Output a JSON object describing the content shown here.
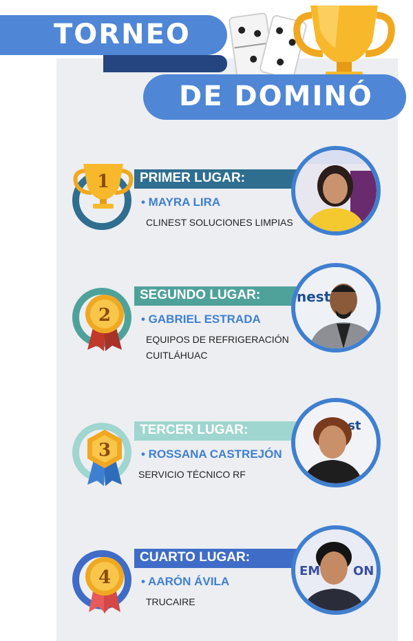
{
  "header": {
    "line1": "TORNEO",
    "line2": "DE DOMINÓ"
  },
  "colors": {
    "brand_blue": "#4f86d6",
    "dark_blue": "#24457f",
    "place1": "#2f6e8f",
    "place2": "#4fa29a",
    "place3": "#9fd6cf",
    "place4": "#3f6cc6",
    "name_blue": "#3f7fd0"
  },
  "entries": [
    {
      "place": "PRIMER LUGAR:",
      "number": "1",
      "name": "• MAYRA LIRA",
      "company": "CLINEST SOLUCIONES LIMPIAS",
      "icon": "trophy-icon"
    },
    {
      "place": "SEGUNDO LUGAR:",
      "number": "2",
      "name": "• GABRIEL ESTRADA",
      "company": "EQUIPOS DE REFRIGERACIÓN CUITLÁHUAC",
      "icon": "medal-icon"
    },
    {
      "place": "TERCER LUGAR:",
      "number": "3",
      "name": "• ROSSANA CASTREJÓN",
      "company": "SERVICIO TÉCNICO RF",
      "icon": "medal-icon"
    },
    {
      "place": "CUARTO LUGAR:",
      "number": "4",
      "name": "• AARÓN ÁVILA",
      "company": "TRUCAIRE",
      "icon": "medal-icon"
    }
  ]
}
